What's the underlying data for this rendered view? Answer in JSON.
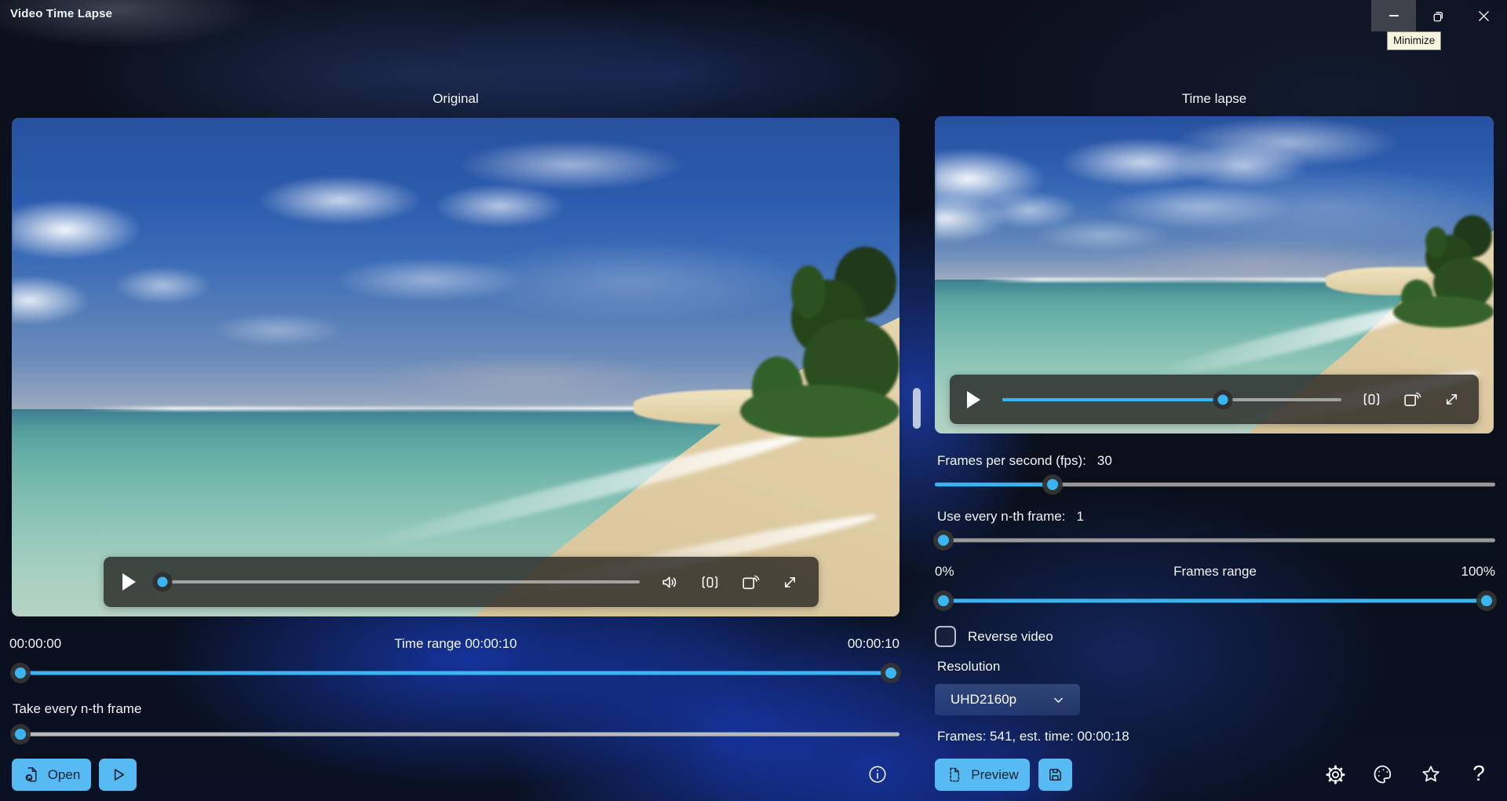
{
  "window": {
    "title": "Video Time Lapse",
    "tooltip_minimize": "Minimize"
  },
  "left_panel": {
    "header": "Original",
    "time_start": "00:00:00",
    "time_range_label": "Time range 00:00:10",
    "time_end": "00:00:10",
    "take_nth_label": "Take every n-th frame",
    "open_button_label": "Open"
  },
  "right_panel": {
    "header": "Time lapse",
    "fps_label": "Frames per second (fps):",
    "fps_value": "30",
    "use_nth_label": "Use every n-th frame:",
    "use_nth_value": "1",
    "frames_range_left": "0%",
    "frames_range_label": "Frames range",
    "frames_range_right": "100%",
    "reverse_video_label": "Reverse video",
    "reverse_video_checked": false,
    "resolution_label": "Resolution",
    "resolution_value": "UHD2160p",
    "frames_info": "Frames: 541, est. time: 00:00:18",
    "preview_button_label": "Preview"
  },
  "sliders": {
    "left_player_progress_pct": 0,
    "left_player_thumb_pct": 1,
    "right_player_progress_pct": 65,
    "time_range_start_pct": 1,
    "time_range_end_pct": 99,
    "time_range_fill_pct": 98,
    "take_nth_pct": 1,
    "fps_pct": 21,
    "use_nth_pct": 1.5,
    "frames_range_start_pct": 1.5,
    "frames_range_end_pct": 98.5,
    "frames_range_fill_pct": 97
  },
  "icons": {
    "help_glyph": "?"
  },
  "colors": {
    "accent_blue": "#3ab5f2",
    "button_blue": "#57baf2",
    "tooltip_bg": "#f5f5e0",
    "track_gray": "#9a9a9a",
    "titlebar_hover": "#3e434b"
  }
}
